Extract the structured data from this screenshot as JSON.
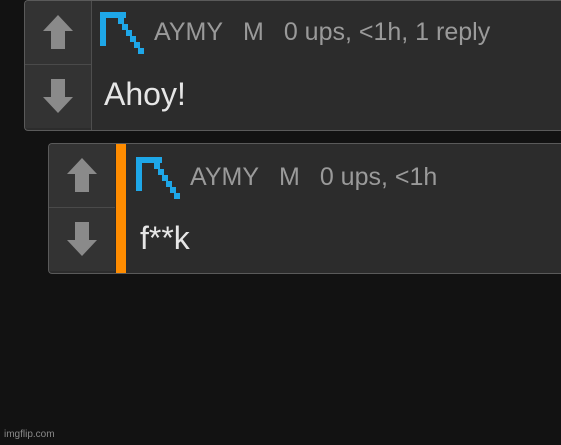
{
  "comments": [
    {
      "username": "AYMY",
      "badge": "M",
      "stats": "0 ups, <1h, 1 reply",
      "text": "Ahoy!",
      "upvote_icon": "arrow-up-icon",
      "downvote_icon": "arrow-down-icon",
      "avatar_icon": "pickaxe-avatar-icon"
    },
    {
      "username": "AYMY",
      "badge": "M",
      "stats": "0 ups, <1h",
      "text": "f**k",
      "upvote_icon": "arrow-up-icon",
      "downvote_icon": "arrow-down-icon",
      "avatar_icon": "pickaxe-avatar-icon",
      "accent_color": "#ff8c00"
    }
  ],
  "watermark": "imgflip.com",
  "colors": {
    "background": "#121212",
    "card": "#2c2c2c",
    "meta_text": "#9a9a9a",
    "body_text": "#e6e6e6",
    "avatar": "#1ea7e8",
    "reply_accent": "#ff8c00"
  }
}
